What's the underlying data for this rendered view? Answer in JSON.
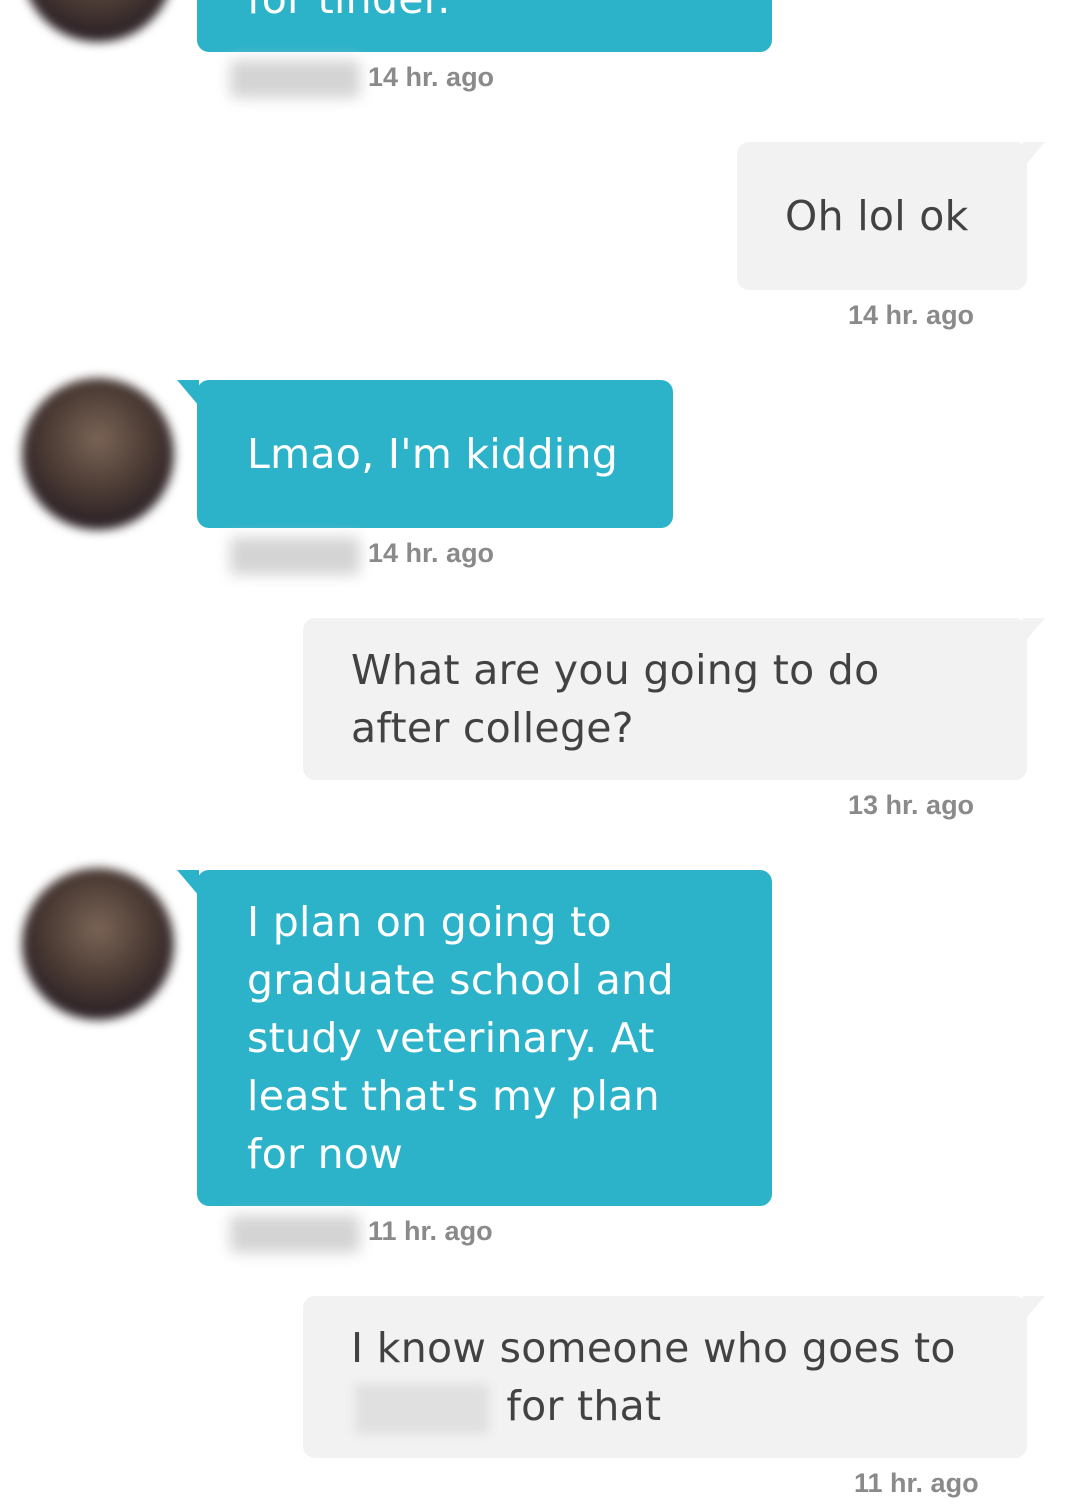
{
  "messages": [
    {
      "side": "in",
      "text": "for tinder.",
      "time": "14 hr. ago"
    },
    {
      "side": "out",
      "text": "Oh lol ok",
      "time": "14 hr. ago"
    },
    {
      "side": "in",
      "text": "Lmao, I'm kidding",
      "time": "14 hr. ago"
    },
    {
      "side": "out",
      "text": "What are you going to do after college?",
      "time": "13 hr. ago"
    },
    {
      "side": "in",
      "text": "I plan on going to graduate school and study veterinary. At least that's my plan for now",
      "time": "11 hr. ago"
    },
    {
      "side": "out",
      "text_before": "I know someone who goes to",
      "text_after": "for that",
      "time": "11 hr. ago"
    }
  ],
  "colors": {
    "incoming_bubble": "#2db3c9",
    "outgoing_bubble": "#f2f2f2",
    "timestamp": "#8a8a8a"
  }
}
